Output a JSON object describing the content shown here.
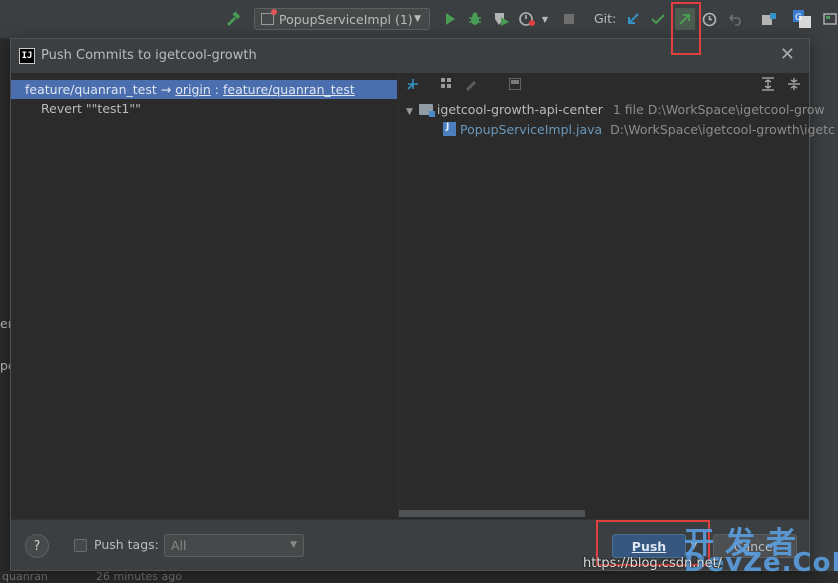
{
  "toolbar": {
    "run_config": "PopupServiceImpl (1)",
    "git_label": "Git:",
    "icons": [
      "build-hammer-icon",
      "run-icon",
      "debug-icon",
      "coverage-icon",
      "profile-icon",
      "stop-icon",
      "git-update-icon",
      "git-commit-icon",
      "git-push-icon",
      "git-history-icon",
      "git-rollback-icon",
      "project-structure-icon",
      "translate-icon",
      "terminal-icon"
    ],
    "colors": {
      "accent_green": "#499c54",
      "accent_blue": "#3592c4",
      "highlight_red": "#e0413e"
    }
  },
  "dialog": {
    "title": "Push Commits to igetcool-growth",
    "app_icon_text": "IJ",
    "branch": {
      "local": "feature/quanran_test",
      "arrow": "→",
      "remote": "origin",
      "sep": ":",
      "remote_branch": "feature/quanran_test"
    },
    "commit_message": "Revert \"\"test1\"\"",
    "tree": {
      "module": "igetcool-growth-api-center",
      "module_meta": "1 file  D:\\WorkSpace\\igetcool-grow",
      "file": "PopupServiceImpl.java",
      "file_meta": "D:\\WorkSpace\\igetcool-growth\\igetc"
    },
    "footer": {
      "help": "?",
      "push_tags_label": "Push tags:",
      "tags_value": "All",
      "push_label": "Push",
      "cancel_label": "Cancel"
    }
  },
  "background": {
    "left_fragment_1": "er",
    "left_fragment_2": "pe",
    "left_fragment_3": "quanran",
    "left_fragment_4": "26 minutes ago"
  },
  "watermark": {
    "cn": "开发者",
    "en": "DevZe.CoM",
    "url": "https://blog.csdn.net/"
  }
}
